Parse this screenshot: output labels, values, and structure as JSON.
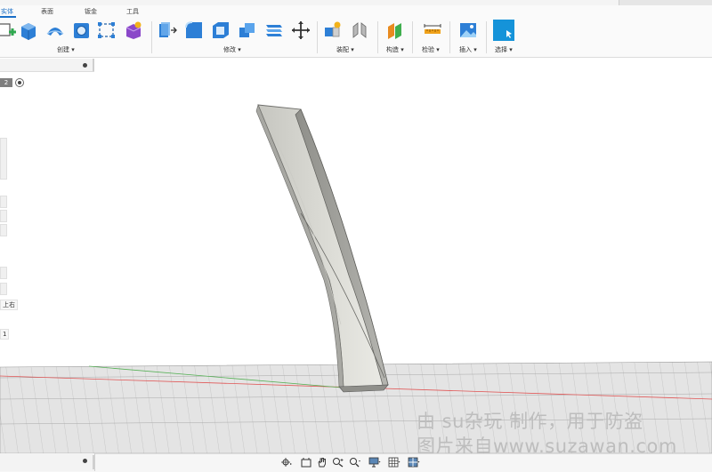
{
  "ribbon": {
    "tabs": [
      {
        "label": "实体"
      },
      {
        "label": "表面"
      },
      {
        "label": "钣金"
      },
      {
        "label": "工具"
      }
    ],
    "groups": [
      {
        "label": "创建 ▾"
      },
      {
        "label": "修改 ▾"
      },
      {
        "label": "装配 ▾"
      },
      {
        "label": "构造 ▾"
      },
      {
        "label": "检验 ▾"
      },
      {
        "label": "插入 ▾"
      },
      {
        "label": "选择 ▾"
      }
    ]
  },
  "browser": {
    "chip_label": "2",
    "fragments": [
      "上右",
      "1"
    ]
  },
  "watermark": {
    "line1": "由 su杂玩 制作，用于防盗",
    "line2": "图片来自www.suzawan.com"
  }
}
